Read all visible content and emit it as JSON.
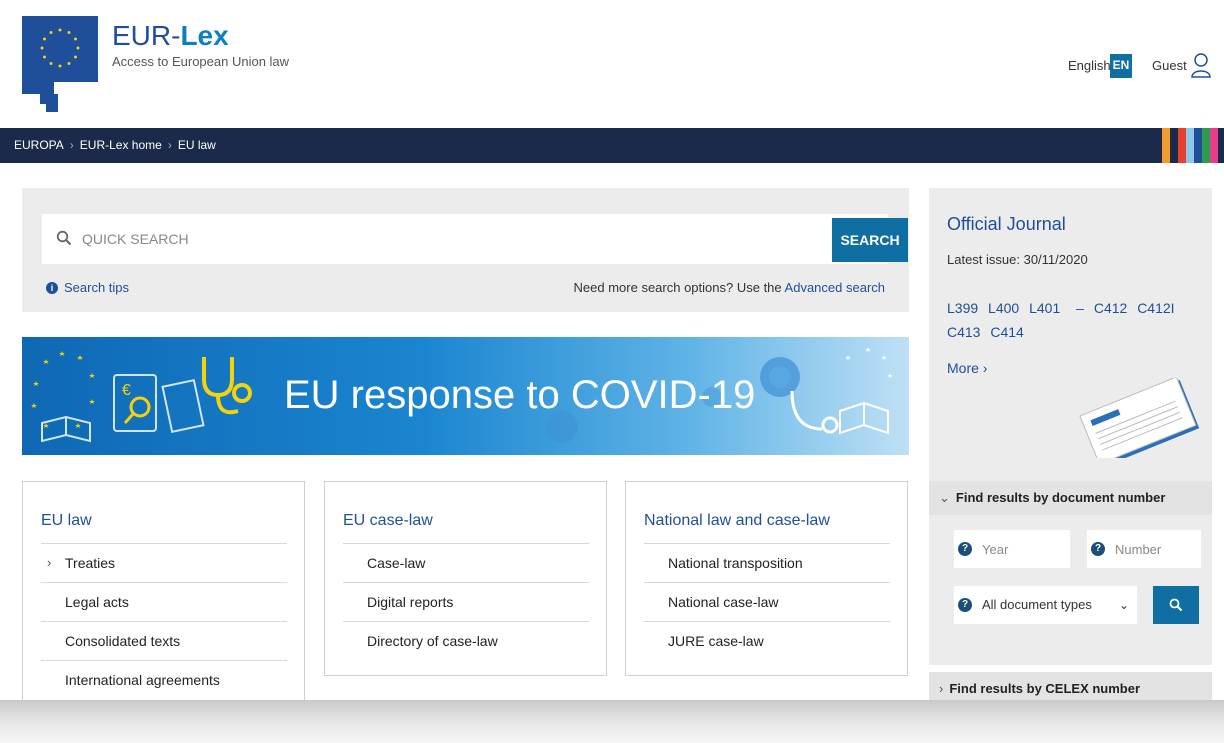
{
  "header": {
    "brand_prefix": "EUR-",
    "brand_suffix": "Lex",
    "tagline": "Access to European Union law",
    "language_label": "English",
    "language_code": "EN",
    "guest_label": "Guest"
  },
  "breadcrumb": {
    "items": [
      "EUROPA",
      "EUR-Lex home",
      "EU law"
    ],
    "separator": "›"
  },
  "search": {
    "placeholder": "QUICK SEARCH",
    "button_label": "SEARCH",
    "tips_label": "Search tips",
    "advanced_prefix": "Need more search options? Use the ",
    "advanced_link": "Advanced search"
  },
  "banner": {
    "text": "EU response to COVID-19"
  },
  "cards": [
    {
      "title": "EU law",
      "items": [
        {
          "label": "Treaties",
          "expandable": true
        },
        {
          "label": "Legal acts",
          "expandable": false
        },
        {
          "label": "Consolidated texts",
          "expandable": false
        },
        {
          "label": "International agreements",
          "expandable": false
        }
      ]
    },
    {
      "title": "EU case-law",
      "items": [
        {
          "label": "Case-law",
          "expandable": false
        },
        {
          "label": "Digital reports",
          "expandable": false
        },
        {
          "label": "Directory of case-law",
          "expandable": false
        }
      ]
    },
    {
      "title": "National law and case-law",
      "items": [
        {
          "label": "National transposition",
          "expandable": false
        },
        {
          "label": "National case-law",
          "expandable": false
        },
        {
          "label": "JURE case-law",
          "expandable": false
        }
      ]
    }
  ],
  "official_journal": {
    "title": "Official Journal",
    "latest_issue": "Latest issue: 30/11/2020",
    "issues": [
      "L399",
      "L400",
      "L401",
      "–",
      "C412",
      "C412I",
      "C413",
      "C414"
    ],
    "more_label": "More ›"
  },
  "doc_number": {
    "header": "Find results by document number",
    "year_placeholder": "Year",
    "number_placeholder": "Number",
    "type_selected": "All document types"
  },
  "celex": {
    "header": "Find results by CELEX number"
  },
  "colors": {
    "brand_blue": "#1f4f9b",
    "button_blue": "#0f6fa3",
    "nav_dark": "#1b2a4a",
    "strips": [
      "#f29a2e",
      "#1b2a4a",
      "#e5412d",
      "#8fc7e8",
      "#1f4f9b",
      "#2e9b4e",
      "#e63d8c"
    ]
  }
}
